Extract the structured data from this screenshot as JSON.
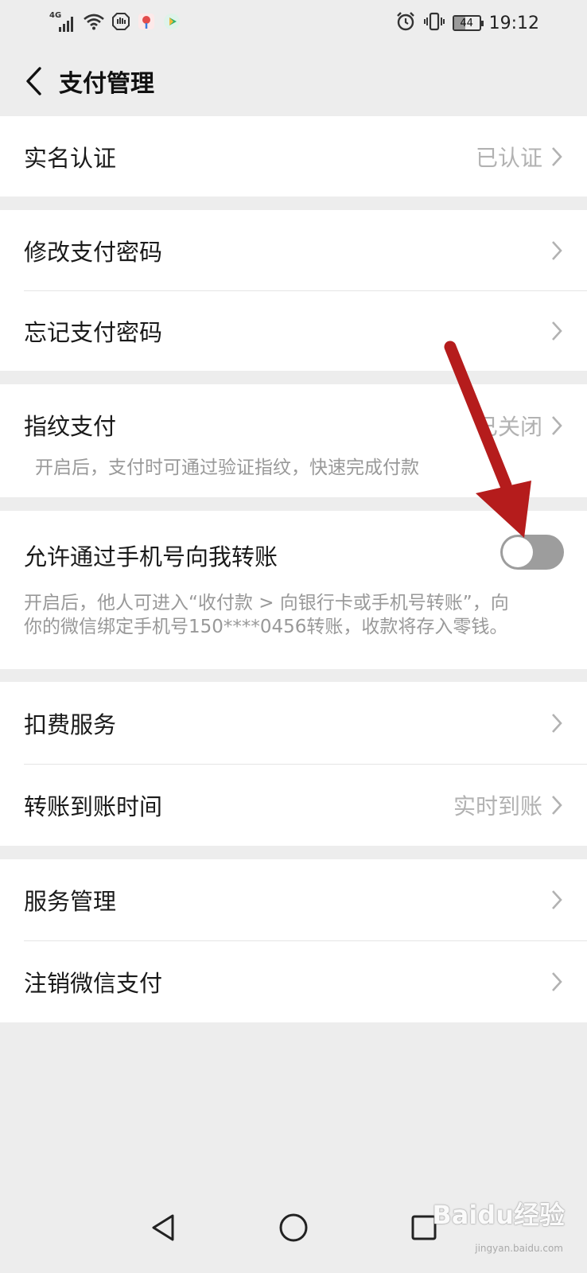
{
  "status_bar": {
    "network_type": "4G",
    "battery_level": "44",
    "time": "19:12",
    "left_icons": [
      "signal-icon",
      "wifi-icon",
      "hand-icon",
      "map-app-icon",
      "play-app-icon"
    ],
    "right_icons": [
      "alarm-icon",
      "vibrate-icon",
      "battery-icon"
    ]
  },
  "header": {
    "title": "支付管理"
  },
  "groups": {
    "realname": {
      "label": "实名认证",
      "value": "已认证"
    },
    "password": {
      "change_label": "修改支付密码",
      "forgot_label": "忘记支付密码"
    },
    "fingerprint": {
      "label": "指纹支付",
      "value": "已关闭",
      "desc": "开启后，支付时可通过验证指纹，快速完成付款"
    },
    "phone_transfer": {
      "label": "允许通过手机号向我转账",
      "enabled": false,
      "desc_line1": "开启后，他人可进入“收付款 > 向银行卡或手机号转账”，向",
      "desc_line2": "你的微信绑定手机号150****0456转账，收款将存入零钱。"
    },
    "services": {
      "deduction_label": "扣费服务",
      "arrival_label": "转账到账时间",
      "arrival_value": "实时到账"
    },
    "manage": {
      "service_label": "服务管理",
      "cancel_label": "注销微信支付"
    }
  },
  "watermark": {
    "text": "Baidu经验",
    "sub": "jingyan.baidu.com"
  },
  "colors": {
    "background": "#ededed",
    "card": "#ffffff",
    "secondary_text": "#b2b2b2",
    "toggle_off": "#9d9d9d",
    "annotation_arrow": "#b51c1c"
  }
}
